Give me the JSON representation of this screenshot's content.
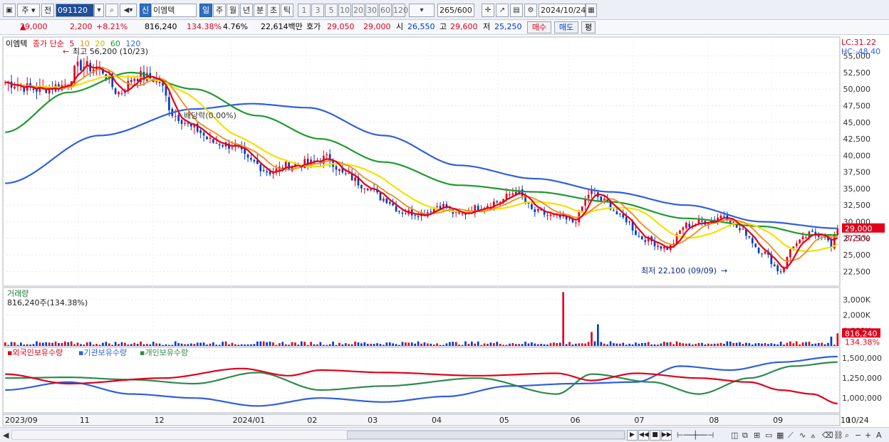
{
  "toolbar": {
    "market_label": "주",
    "prev_label": "전",
    "code": "091120",
    "new_badge": "신",
    "stock_name": "이엠텍",
    "periods": [
      "일",
      "주",
      "월",
      "년",
      "분",
      "초",
      "틱"
    ],
    "active_period": "일",
    "intervals": [
      "1",
      "3",
      "5",
      "10",
      "20",
      "30",
      "60",
      "120"
    ],
    "count": "265",
    "count_total": "/600",
    "date": "2024/10/24"
  },
  "info": {
    "price": "29,000",
    "change": "2,200",
    "change_pct": "+8.21%",
    "volume": "816,240",
    "volume_ratio": "134.38%",
    "turnover": "4.76%",
    "amount": "22,614백만",
    "quote_label": "호가",
    "ask": "29,050",
    "bid": "29,000",
    "open_label": "시",
    "open": "26,550",
    "high_label": "고",
    "high": "29,600",
    "low_label": "저",
    "low": "25,250",
    "buy_label": "매수",
    "sell_label": "매도",
    "avg_label": "평"
  },
  "legend": {
    "name": "이엠텍",
    "type": "종가 단순",
    "ma5": "5",
    "ma10": "10",
    "ma20": "20",
    "ma60": "60",
    "ma120": "120"
  },
  "right_info": {
    "lc": "LC:31.22",
    "hc": "HC:-48.40"
  },
  "annotations": {
    "max": "최고 56,200 (10/23)",
    "min": "최저 22,100 (09/09)",
    "dividend": "배당락(0.00%)"
  },
  "volume_panel": {
    "title": "거래량",
    "value": "816,240주(134.38%)",
    "last_label": "816,240",
    "last_pct": "134.38%"
  },
  "holding_panel": {
    "foreign": "외국인보유수량",
    "inst": "기관보유수량",
    "indiv": "개인보유수량"
  },
  "price_axis": [
    "55,000",
    "52,500",
    "50,000",
    "47,500",
    "45,000",
    "42,500",
    "40,000",
    "37,500",
    "35,000",
    "32,500",
    "30,000",
    "27,500",
    "25,000",
    "22,500"
  ],
  "price_label": "29,000",
  "price_pct": "8.21%",
  "volume_axis": [
    "3,000K",
    "2,000K",
    "1,000K"
  ],
  "holding_axis": [
    "1,500,000",
    "1,250,000",
    "1,000,000"
  ],
  "date_axis": [
    "2023/09",
    "11",
    "12",
    "2024/01",
    "02",
    "03",
    "04",
    "05",
    "06",
    "07",
    "08",
    "09",
    "10"
  ],
  "date_corner": "10/24",
  "colors": {
    "up": "#e0001b",
    "down": "#0039c8",
    "ma5": "#e0001b",
    "ma10": "#f08c1a",
    "ma20": "#f5e100",
    "ma60": "#1e9a2e",
    "ma120": "#2f5fe0",
    "foreign": "#e0001b",
    "inst": "#2f5fe0",
    "indiv": "#2e8b4e"
  },
  "chart_data": {
    "type": "line",
    "days": 265,
    "x_dates": [
      "2023/09",
      "11",
      "12",
      "2024/01",
      "02",
      "03",
      "04",
      "05",
      "06",
      "07",
      "08",
      "09",
      "10"
    ],
    "ylim": [
      20500,
      57000
    ],
    "close_anchors": [
      [
        0,
        51000
      ],
      [
        10,
        50000
      ],
      [
        18,
        50500
      ],
      [
        24,
        53500
      ],
      [
        30,
        53000
      ],
      [
        36,
        49500
      ],
      [
        42,
        52000
      ],
      [
        48,
        51500
      ],
      [
        54,
        46000
      ],
      [
        60,
        44000
      ],
      [
        66,
        42000
      ],
      [
        72,
        41500
      ],
      [
        78,
        39000
      ],
      [
        84,
        37500
      ],
      [
        90,
        38500
      ],
      [
        96,
        38800
      ],
      [
        102,
        39600
      ],
      [
        108,
        37000
      ],
      [
        114,
        35500
      ],
      [
        120,
        33500
      ],
      [
        126,
        31500
      ],
      [
        132,
        31200
      ],
      [
        138,
        32500
      ],
      [
        144,
        31000
      ],
      [
        150,
        32200
      ],
      [
        156,
        33000
      ],
      [
        162,
        34500
      ],
      [
        168,
        31500
      ],
      [
        174,
        30800
      ],
      [
        180,
        30000
      ],
      [
        186,
        34500
      ],
      [
        190,
        33000
      ],
      [
        196,
        30500
      ],
      [
        202,
        27500
      ],
      [
        210,
        26000
      ],
      [
        216,
        29500
      ],
      [
        222,
        30000
      ],
      [
        228,
        31000
      ],
      [
        234,
        28500
      ],
      [
        240,
        25500
      ],
      [
        246,
        22500
      ],
      [
        250,
        26500
      ],
      [
        256,
        28200
      ],
      [
        260,
        28000
      ],
      [
        262,
        26000
      ],
      [
        264,
        29000
      ]
    ],
    "ma120_anchors": [
      [
        0,
        35800
      ],
      [
        30,
        43000
      ],
      [
        60,
        47000
      ],
      [
        78,
        47800
      ],
      [
        96,
        47200
      ],
      [
        120,
        43000
      ],
      [
        144,
        38500
      ],
      [
        168,
        36500
      ],
      [
        192,
        34500
      ],
      [
        216,
        32500
      ],
      [
        240,
        30000
      ],
      [
        264,
        29000
      ]
    ],
    "ma60_anchors": [
      [
        0,
        43500
      ],
      [
        20,
        49500
      ],
      [
        40,
        52500
      ],
      [
        60,
        50000
      ],
      [
        80,
        46000
      ],
      [
        100,
        42500
      ],
      [
        120,
        39000
      ],
      [
        144,
        35500
      ],
      [
        168,
        34500
      ],
      [
        192,
        33000
      ],
      [
        216,
        30500
      ],
      [
        240,
        29300
      ],
      [
        256,
        28000
      ],
      [
        264,
        28000
      ]
    ],
    "volume_k": {
      "range": [
        0,
        3500
      ],
      "spikes": [
        [
          177,
          3800
        ],
        [
          186,
          900
        ],
        [
          188,
          1400
        ],
        [
          262,
          600
        ],
        [
          264,
          816
        ]
      ],
      "base": 150
    },
    "holdings": {
      "ylim": [
        850000,
        1600000
      ],
      "foreign_anchors": [
        [
          0,
          1300000
        ],
        [
          20,
          1180000
        ],
        [
          50,
          1250000
        ],
        [
          75,
          1370000
        ],
        [
          90,
          1280000
        ],
        [
          100,
          1350000
        ],
        [
          120,
          1320000
        ],
        [
          150,
          1280000
        ],
        [
          175,
          1310000
        ],
        [
          186,
          1220000
        ],
        [
          200,
          1310000
        ],
        [
          220,
          1250000
        ],
        [
          236,
          1200000
        ],
        [
          246,
          1100000
        ],
        [
          256,
          1050000
        ],
        [
          264,
          930000
        ]
      ],
      "inst_anchors": [
        [
          0,
          1100000
        ],
        [
          20,
          1200000
        ],
        [
          40,
          1050000
        ],
        [
          60,
          1000000
        ],
        [
          80,
          900000
        ],
        [
          100,
          1000000
        ],
        [
          120,
          950000
        ],
        [
          140,
          1020000
        ],
        [
          160,
          1150000
        ],
        [
          180,
          1180000
        ],
        [
          200,
          1200000
        ],
        [
          214,
          1400000
        ],
        [
          230,
          1350000
        ],
        [
          246,
          1450000
        ],
        [
          264,
          1520000
        ]
      ],
      "indiv_anchors": [
        [
          0,
          1250000
        ],
        [
          20,
          1260000
        ],
        [
          40,
          1230000
        ],
        [
          60,
          1180000
        ],
        [
          80,
          1320000
        ],
        [
          100,
          1100000
        ],
        [
          120,
          1150000
        ],
        [
          150,
          1250000
        ],
        [
          175,
          1050000
        ],
        [
          186,
          1300000
        ],
        [
          205,
          1200000
        ],
        [
          220,
          1050000
        ],
        [
          236,
          1250000
        ],
        [
          250,
          1400000
        ],
        [
          264,
          1450000
        ]
      ]
    }
  }
}
